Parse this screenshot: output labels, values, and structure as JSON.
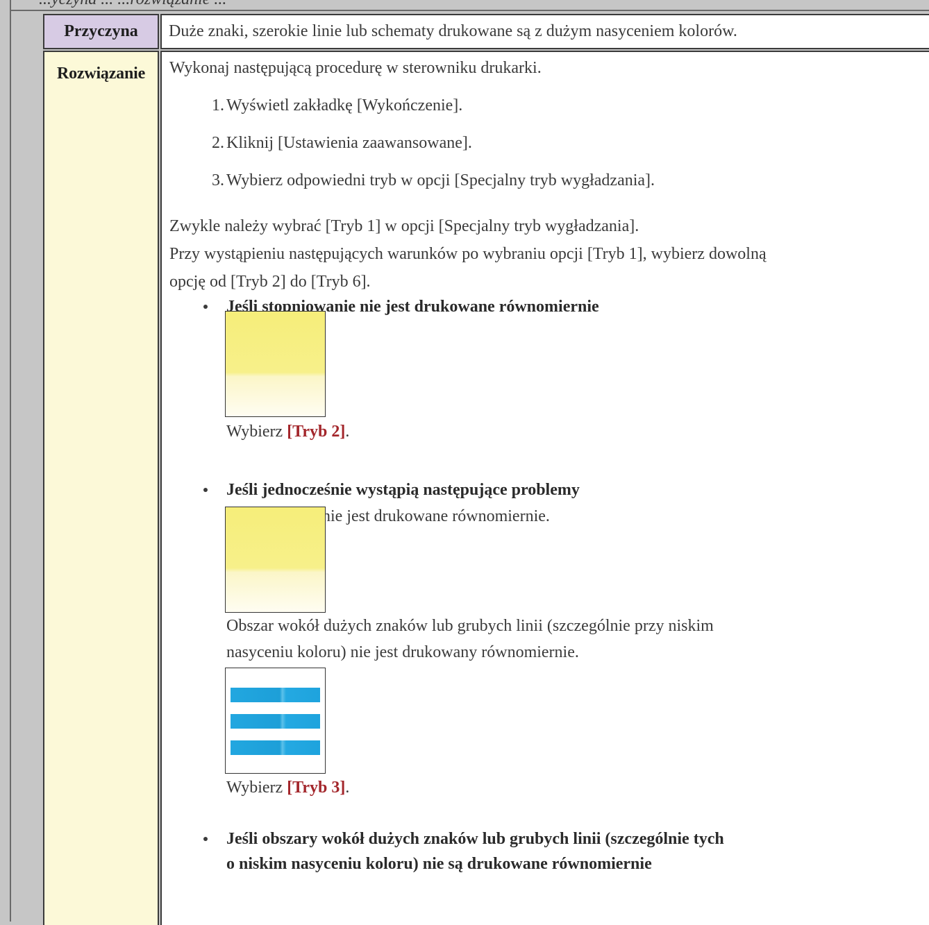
{
  "header": {
    "partial_title": "...yczyna ... ...rozwiązanie ..."
  },
  "cause": {
    "label": "Przyczyna",
    "text": "Duże znaki, szerokie linie lub schematy drukowane są z dużym nasyceniem kolorów."
  },
  "solution": {
    "label": "Rozwiązanie",
    "intro": "Wykonaj następującą procedurę w sterowniku drukarki.",
    "steps": [
      {
        "num": "1.",
        "text": "Wyświetl zakładkę [Wykończenie]."
      },
      {
        "num": "2.",
        "text": "Kliknij [Ustawienia zaawansowane]."
      },
      {
        "num": "3.",
        "text": "Wybierz odpowiedni tryb w opcji [Specjalny tryb wygładzania]."
      }
    ],
    "para1": "Zwykle należy wybrać [Tryb 1] w opcji [Specjalny tryb wygładzania].",
    "para2_line1": "Przy wystąpieniu następujących warunków po wybraniu opcji [Tryb 1], wybierz dowolną",
    "para2_line2": "opcję od [Tryb 2] do [Tryb 6].",
    "bullets": {
      "b1_title": "Jeśli stopniowanie nie jest drukowane równomiernie",
      "b1_choose_prefix": "Wybierz ",
      "b1_mode": "[Tryb 2]",
      "b1_choose_suffix": ".",
      "b2_title": "Jeśli jednocześnie wystąpią następujące problemy",
      "b2_desc1": "Stopniowanie nie jest drukowane równomiernie.",
      "b2_desc2_line1": "Obszar wokół dużych znaków lub grubych linii (szczególnie przy niskim",
      "b2_desc2_line2": "nasyceniu koloru) nie jest drukowany równomiernie.",
      "b2_choose_prefix": "Wybierz ",
      "b2_mode": "[Tryb 3]",
      "b2_choose_suffix": ".",
      "b3_title_line1": "Jeśli obszary wokół dużych znaków lub grubych linii (szczególnie tych",
      "b3_title_line2": "o niskim nasyceniu koloru) nie są drukowane równomiernie"
    }
  },
  "colors": {
    "cause_label_bg": "#d7cbe4",
    "solution_label_bg": "#fcf9d8",
    "mode_text": "#a3262b",
    "gradient_yellow": "#f6ee7a",
    "line_blue": "#22a7e0"
  }
}
